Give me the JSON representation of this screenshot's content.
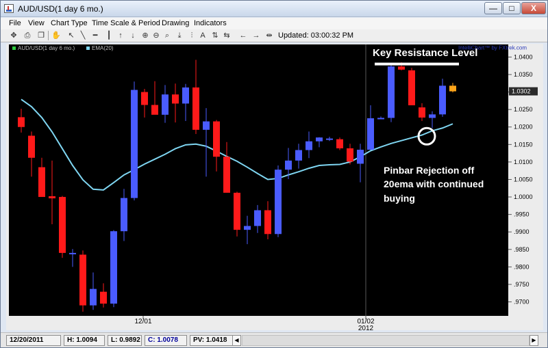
{
  "window": {
    "title": "AUD/USD(1 day  6 mo.)",
    "min_label": "—",
    "max_label": "□",
    "close_label": "X"
  },
  "menu": [
    "File",
    "View",
    "Chart Type",
    "Time Scale & Period",
    "Drawing",
    "Indicators"
  ],
  "toolbar": {
    "icons": [
      "crosshair-icon",
      "print-icon",
      "copy-icon",
      "hand-icon",
      "cursor-icon",
      "trendline-icon",
      "horizontal-line-icon",
      "vertical-line-icon",
      "arrow-up-icon",
      "arrow-down-icon",
      "zoom-in-icon",
      "zoom-out-icon",
      "magnify-icon",
      "download-icon",
      "bar-icon",
      "text-icon",
      "buy-icon",
      "sell-icon",
      "scroll-left-icon",
      "scroll-right-icon",
      "fit-icon"
    ],
    "updated": "Updated: 03:00:32 PM"
  },
  "chart": {
    "legend_instrument": "AUD/USD(1 day  6 mo.)",
    "legend_ema": "EMA(20)",
    "brand": "IntelliChart™ by FXtrek.com",
    "current_price_label": "1.0302",
    "y_ticks": [
      "1.0400",
      "1.0350",
      "1.0300",
      "1.0250",
      "1.0200",
      "1.0150",
      "1.0100",
      "1.0050",
      "1.0000",
      ".9950",
      ".9900",
      ".9850",
      ".9800",
      ".9750",
      ".9700"
    ],
    "x_ticks": [
      "12/01",
      "01/02"
    ],
    "x_year": "2012",
    "annotation_resistance": "Key Resistance Level",
    "annotation_pinbar_1": "Pinbar Rejection off",
    "annotation_pinbar_2": "20ema with continued",
    "annotation_pinbar_3": "buying",
    "colors": {
      "bull": "#4a5cff",
      "bear": "#ff1a1a",
      "ema": "#7fd6f2",
      "last": "#ffa51a",
      "background": "#000000"
    }
  },
  "chart_data": {
    "type": "candlestick",
    "title": "AUD/USD(1 day  6 mo.)",
    "ylim": [
      0.966,
      1.0436
    ],
    "candles": [
      {
        "o": 1.0228,
        "h": 1.0252,
        "l": 1.0184,
        "c": 1.02
      },
      {
        "o": 1.0175,
        "h": 1.0187,
        "l": 1.0058,
        "c": 1.0112
      },
      {
        "o": 1.0085,
        "h": 1.0112,
        "l": 1.0,
        "c": 1.0
      },
      {
        "o": 1.0002,
        "h": 1.0104,
        "l": 0.9922,
        "c": 0.9996
      },
      {
        "o": 1.0,
        "h": 1.0003,
        "l": 0.9826,
        "c": 0.984
      },
      {
        "o": 0.984,
        "h": 0.9851,
        "l": 0.98,
        "c": 0.984
      },
      {
        "o": 0.9835,
        "h": 0.9847,
        "l": 0.9672,
        "c": 0.969
      },
      {
        "o": 0.969,
        "h": 0.9784,
        "l": 0.9677,
        "c": 0.9737
      },
      {
        "o": 0.9729,
        "h": 0.9753,
        "l": 0.9684,
        "c": 0.9695
      },
      {
        "o": 0.9695,
        "h": 0.9905,
        "l": 0.9685,
        "c": 0.9902
      },
      {
        "o": 0.9902,
        "h": 1.0023,
        "l": 0.9874,
        "c": 0.9997
      },
      {
        "o": 0.9997,
        "h": 1.033,
        "l": 0.999,
        "c": 1.0306
      },
      {
        "o": 1.03,
        "h": 1.0309,
        "l": 1.0227,
        "c": 1.0263
      },
      {
        "o": 1.0263,
        "h": 1.0331,
        "l": 1.0237,
        "c": 1.0235
      },
      {
        "o": 1.0235,
        "h": 1.032,
        "l": 1.0212,
        "c": 1.0293
      },
      {
        "o": 1.0293,
        "h": 1.0324,
        "l": 1.0213,
        "c": 1.0267
      },
      {
        "o": 1.0267,
        "h": 1.0323,
        "l": 1.0217,
        "c": 1.0313
      },
      {
        "o": 1.0313,
        "h": 1.0392,
        "l": 1.018,
        "c": 1.0192
      },
      {
        "o": 1.0192,
        "h": 1.0254,
        "l": 1.0058,
        "c": 1.0216
      },
      {
        "o": 1.0216,
        "h": 1.022,
        "l": 1.0073,
        "c": 1.0115
      },
      {
        "o": 1.0115,
        "h": 1.0157,
        "l": 1.0034,
        "c": 1.0012
      },
      {
        "o": 1.0012,
        "h": 1.0015,
        "l": 0.9887,
        "c": 0.9906
      },
      {
        "o": 0.9906,
        "h": 0.9946,
        "l": 0.9865,
        "c": 0.9917
      },
      {
        "o": 0.9917,
        "h": 0.9977,
        "l": 0.9897,
        "c": 0.9962
      },
      {
        "o": 0.9962,
        "h": 0.9988,
        "l": 0.9879,
        "c": 0.9894
      },
      {
        "o": 0.9894,
        "h": 1.009,
        "l": 0.9885,
        "c": 1.0078
      },
      {
        "o": 1.0078,
        "h": 1.014,
        "l": 1.0051,
        "c": 1.0104
      },
      {
        "o": 1.0104,
        "h": 1.0152,
        "l": 1.0081,
        "c": 1.0134
      },
      {
        "o": 1.0134,
        "h": 1.0187,
        "l": 1.0111,
        "c": 1.0159
      },
      {
        "o": 1.0159,
        "h": 1.0171,
        "l": 1.0142,
        "c": 1.017
      },
      {
        "o": 1.0167,
        "h": 1.0172,
        "l": 1.016,
        "c": 1.0167
      },
      {
        "o": 1.0165,
        "h": 1.017,
        "l": 1.0134,
        "c": 1.0139
      },
      {
        "o": 1.0139,
        "h": 1.0152,
        "l": 1.0093,
        "c": 1.0101
      },
      {
        "o": 1.0095,
        "h": 1.0152,
        "l": 1.0042,
        "c": 1.0135
      },
      {
        "o": 1.0135,
        "h": 1.0262,
        "l": 1.0134,
        "c": 1.0225
      },
      {
        "o": 1.0225,
        "h": 1.023,
        "l": 1.0224,
        "c": 1.0226
      },
      {
        "o": 1.0226,
        "h": 1.0378,
        "l": 1.0214,
        "c": 1.0373
      },
      {
        "o": 1.0373,
        "h": 1.0385,
        "l": 1.0362,
        "c": 1.0364
      },
      {
        "o": 1.0362,
        "h": 1.0369,
        "l": 1.0262,
        "c": 1.0262
      },
      {
        "o": 1.0256,
        "h": 1.0268,
        "l": 1.0217,
        "c": 1.0227
      },
      {
        "o": 1.0226,
        "h": 1.0245,
        "l": 1.0197,
        "c": 1.0236
      },
      {
        "o": 1.0236,
        "h": 1.0338,
        "l": 1.0229,
        "c": 1.0318
      },
      {
        "o": 1.0318,
        "h": 1.0326,
        "l": 1.0299,
        "c": 1.0302
      }
    ],
    "ema20": [
      1.0279,
      1.0258,
      1.0227,
      1.0186,
      1.0138,
      1.009,
      1.0049,
      1.0022,
      1.002,
      1.0041,
      1.0063,
      1.0078,
      1.0094,
      1.0108,
      1.0122,
      1.0138,
      1.0149,
      1.0151,
      1.0145,
      1.0131,
      1.0116,
      1.0102,
      1.0085,
      1.0067,
      1.005,
      1.0053,
      1.0063,
      1.0072,
      1.0082,
      1.009,
      1.0092,
      1.0093,
      1.01,
      1.0115,
      1.0132,
      1.0143,
      1.0153,
      1.0161,
      1.0169,
      1.0177,
      1.0189,
      1.0197,
      1.0209
    ],
    "x_ticks": [
      "12/01",
      "01/02"
    ],
    "resistance_level": 1.038
  },
  "status": {
    "date": "12/20/2011",
    "high": "H: 1.0094",
    "low": "L: 0.9892",
    "close": "C: 1.0078",
    "pv": "PV: 1.0418"
  }
}
